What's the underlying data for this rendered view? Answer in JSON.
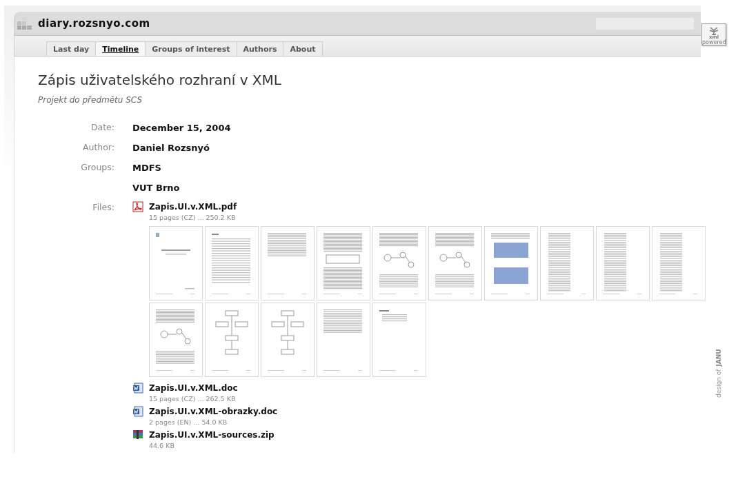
{
  "site": {
    "title": "diary.rozsnyo.com",
    "badge": [
      "xml",
      "powered"
    ]
  },
  "tabs": [
    {
      "label": "Last day",
      "selected": false
    },
    {
      "label": "Timeline",
      "selected": true
    },
    {
      "label": "Groups of interest",
      "selected": false
    },
    {
      "label": "Authors",
      "selected": false
    },
    {
      "label": "About",
      "selected": false
    }
  ],
  "article": {
    "title": "Zápis uživatelského rozhraní v XML",
    "subtitle": "Projekt do předmětu SCS",
    "fields": [
      {
        "label": "Date:",
        "values": [
          "December 15, 2004"
        ]
      },
      {
        "label": "Author:",
        "values": [
          "Daniel Rozsnyó"
        ]
      },
      {
        "label": "Groups:",
        "values": [
          "MDFS",
          "VUT Brno"
        ]
      }
    ],
    "files_label": "Files:",
    "files": [
      {
        "kind": "pdf",
        "name": "Zapis.UI.v.XML.pdf",
        "info": "15 pages (CZ) ... 250.2 KB",
        "thumbnails": [
          {
            "kind": "cover"
          },
          {
            "kind": "toc"
          },
          {
            "kind": "text"
          },
          {
            "kind": "table"
          },
          {
            "kind": "diagram"
          },
          {
            "kind": "diagram"
          },
          {
            "kind": "screenshot"
          },
          {
            "kind": "code"
          },
          {
            "kind": "code"
          },
          {
            "kind": "code"
          },
          {
            "kind": "diagram"
          },
          {
            "kind": "flowchart"
          },
          {
            "kind": "flowchart"
          },
          {
            "kind": "text"
          },
          {
            "kind": "list"
          }
        ]
      },
      {
        "kind": "doc",
        "name": "Zapis.UI.v.XML.doc",
        "info": "15 pages (CZ) ... 262.5 KB"
      },
      {
        "kind": "doc",
        "name": "Zapis.UI.v.XML-obrazky.doc",
        "info": "2 pages (EN) ... 54.0 KB"
      },
      {
        "kind": "zip",
        "name": "Zapis.UI.v.XML-sources.zip",
        "info": "44.6 KB"
      }
    ]
  },
  "side_credit": {
    "text": "design of",
    "author": "JANU"
  }
}
